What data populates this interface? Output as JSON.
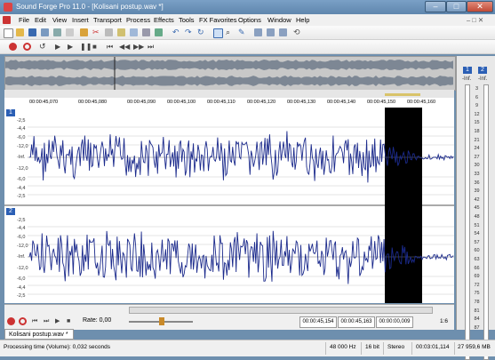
{
  "window": {
    "title": "Sound Forge Pro 11.0 - [Kolisani postup.wav *]"
  },
  "menu": [
    "File",
    "Edit",
    "View",
    "Insert",
    "Transport",
    "Process",
    "Effects",
    "Tools",
    "FX Favorites",
    "Options",
    "Window",
    "Help"
  ],
  "ruler": {
    "ticks": [
      "00:00:45,070",
      "00:00:45,080",
      "00:00:45,090",
      "00:00:45,100",
      "00:00:45,110",
      "00:00:45,120",
      "00:00:45,130",
      "00:00:45,140",
      "00:00:45,150",
      "00:00:45,160"
    ]
  },
  "channels": [
    {
      "label": "1",
      "db_scale": [
        "-2,5",
        "-4,4",
        "-6,0",
        "-12,0",
        "-Inf.",
        "-12,0",
        "-6,0",
        "-4,4",
        "-2,5"
      ]
    },
    {
      "label": "2",
      "db_scale": [
        "-2,5",
        "-4,4",
        "-6,0",
        "-12,0",
        "-Inf.",
        "-12,0",
        "-6,0",
        "-4,4",
        "-2,5"
      ]
    }
  ],
  "meters": {
    "ch1": "1",
    "ch2": "2",
    "ch1_level": "-Inf.",
    "ch2_level": "-Inf.",
    "scale": [
      "3",
      "6",
      "9",
      "12",
      "15",
      "18",
      "21",
      "24",
      "27",
      "30",
      "33",
      "36",
      "39",
      "42",
      "45",
      "48",
      "51",
      "54",
      "57",
      "60",
      "63",
      "66",
      "69",
      "72",
      "75",
      "78",
      "81",
      "84",
      "87"
    ]
  },
  "transport": {
    "rate_label": "Rate: 0,00"
  },
  "times": {
    "start": "00:00:45,154",
    "end": "00:00:45,163",
    "length": "00:00:00,009",
    "zoom": "1:6"
  },
  "tab": {
    "label": "Kolisani postup.wav *"
  },
  "status": {
    "processing": "Processing time (Volume): 0,032 seconds",
    "rate": "48 000 Hz",
    "bits": "16 bit",
    "channels": "Stereo",
    "length": "00:03:01,114",
    "disk": "27 959,6 MB"
  }
}
